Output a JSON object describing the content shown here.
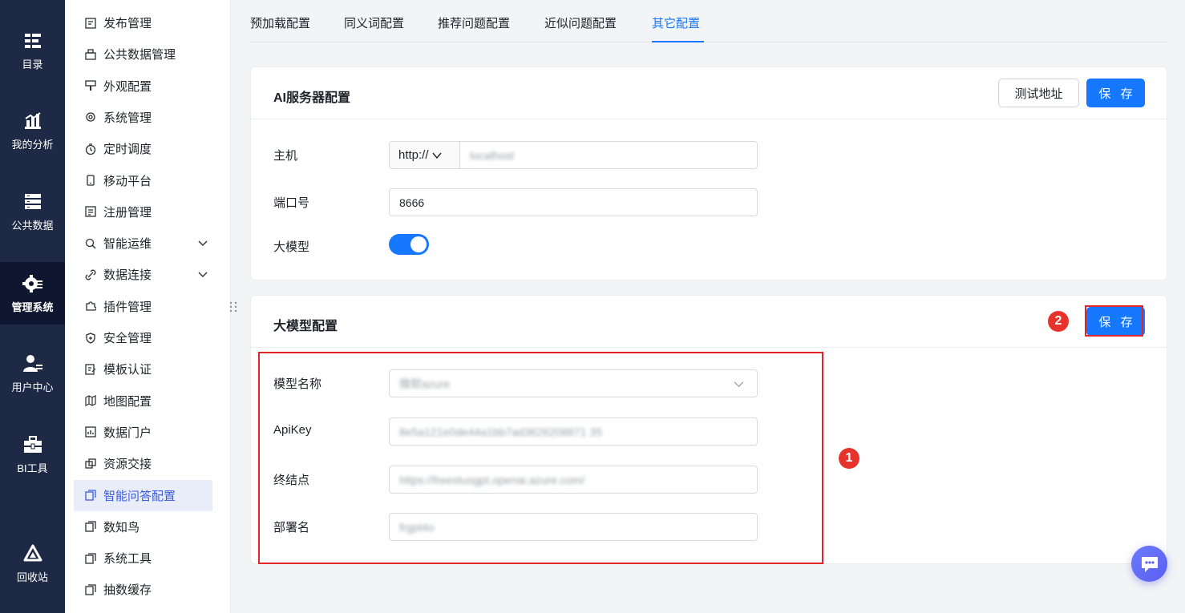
{
  "rail": [
    {
      "label": "目录",
      "icon": "catalog-icon"
    },
    {
      "label": "我的分析",
      "icon": "analysis-icon"
    },
    {
      "label": "公共数据",
      "icon": "database-icon"
    },
    {
      "label": "管理系统",
      "icon": "gear-icon",
      "active": true
    },
    {
      "label": "用户中心",
      "icon": "user-icon"
    },
    {
      "label": "BI工具",
      "icon": "toolbox-icon"
    },
    {
      "label": "回收站",
      "icon": "recycle-icon"
    }
  ],
  "sidebar": [
    {
      "label": "发布管理",
      "icon": "publish-icon"
    },
    {
      "label": "公共数据管理",
      "icon": "public-data-icon"
    },
    {
      "label": "外观配置",
      "icon": "brush-icon"
    },
    {
      "label": "系统管理",
      "icon": "settings-icon"
    },
    {
      "label": "定时调度",
      "icon": "timer-icon"
    },
    {
      "label": "移动平台",
      "icon": "mobile-icon"
    },
    {
      "label": "注册管理",
      "icon": "register-icon"
    },
    {
      "label": "智能运维",
      "icon": "ops-icon",
      "expandable": true
    },
    {
      "label": "数据连接",
      "icon": "link-icon",
      "expandable": true
    },
    {
      "label": "插件管理",
      "icon": "plugin-icon"
    },
    {
      "label": "安全管理",
      "icon": "shield-icon"
    },
    {
      "label": "模板认证",
      "icon": "certify-icon"
    },
    {
      "label": "地图配置",
      "icon": "map-icon"
    },
    {
      "label": "数据门户",
      "icon": "portal-icon"
    },
    {
      "label": "资源交接",
      "icon": "handover-icon"
    },
    {
      "label": "智能问答配置",
      "icon": "qa-icon",
      "active": true
    },
    {
      "label": "数知鸟",
      "icon": "copy-icon"
    },
    {
      "label": "系统工具",
      "icon": "copy-icon"
    },
    {
      "label": "抽数缓存",
      "icon": "copy-icon"
    }
  ],
  "tabs": [
    "预加载配置",
    "同义词配置",
    "推荐问题配置",
    "近似问题配置",
    "其它配置"
  ],
  "ai_server": {
    "title": "AI服务器配置",
    "test_button": "测试地址",
    "save_button": "保 存",
    "host_label": "主机",
    "protocol": "http://",
    "host_value": "localhost",
    "port_label": "端口号",
    "port_value": "8666",
    "llm_label": "大模型",
    "llm_enabled": true
  },
  "llm_config": {
    "title": "大模型配置",
    "save_button": "保 存",
    "model_label": "模型名称",
    "model_value": "微软azure",
    "apikey_label": "ApiKey",
    "apikey_value": "8e5a121e0de44a1bb7ad3626208871 35",
    "endpoint_label": "终结点",
    "endpoint_value": "https://freestuogpt.openai.azure.com/",
    "deploy_label": "部署名",
    "deploy_value": "frgpt4o"
  },
  "annotations": {
    "badge_1": "1",
    "badge_2": "2"
  },
  "colors": {
    "accent": "#1677ff",
    "rail_bg": "#1e2a45",
    "highlight": "#e0262b"
  }
}
